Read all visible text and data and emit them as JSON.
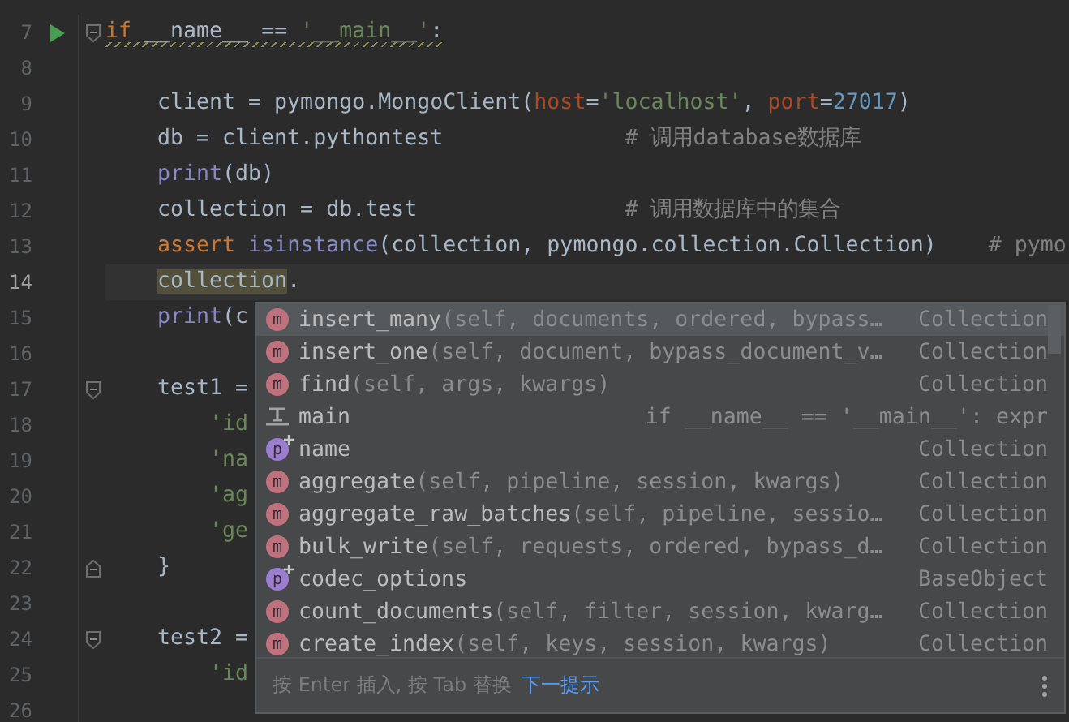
{
  "editor": {
    "lines": [
      {
        "number": "7",
        "current": false,
        "run": true,
        "fold_start": true,
        "warning": true,
        "tokens": [
          {
            "kind": "keyword",
            "text": "if"
          },
          {
            "kind": "plain",
            "text": " __name__ == "
          },
          {
            "kind": "string",
            "text": "'__main__'"
          },
          {
            "kind": "plain",
            "text": ":"
          }
        ],
        "children": [
          {
            "number": "8",
            "current": false
          },
          {
            "number": "9",
            "current": false,
            "tokens": [
              {
                "kind": "plain",
                "text": "client = pymongo.MongoClient("
              },
              {
                "kind": "param",
                "text": "host"
              },
              {
                "kind": "plain",
                "text": "="
              },
              {
                "kind": "string",
                "text": "'localhost'"
              },
              {
                "kind": "plain",
                "text": ", "
              },
              {
                "kind": "param",
                "text": "port"
              },
              {
                "kind": "plain",
                "text": "="
              },
              {
                "kind": "number",
                "text": "27017"
              },
              {
                "kind": "plain",
                "text": ")"
              }
            ]
          },
          {
            "number": "10",
            "current": false,
            "tokens": [
              {
                "kind": "plain",
                "text": "db = client.pythontest              "
              },
              {
                "kind": "comment",
                "text": "# 调用database数据库"
              }
            ]
          },
          {
            "number": "11",
            "current": false,
            "tokens": [
              {
                "kind": "builtin",
                "text": "print"
              },
              {
                "kind": "plain",
                "text": "(db)"
              }
            ]
          },
          {
            "number": "12",
            "current": false,
            "tokens": [
              {
                "kind": "plain",
                "text": "collection = db.test                "
              },
              {
                "kind": "comment",
                "text": "# 调用数据库中的集合"
              }
            ]
          },
          {
            "number": "13",
            "current": false,
            "tokens": [
              {
                "kind": "keyword",
                "text": "assert"
              },
              {
                "kind": "builtin",
                "text": " isinstance"
              },
              {
                "kind": "plain",
                "text": "(collection, pymongo.collection.Collection)    "
              },
              {
                "kind": "comment",
                "text": "# pymo"
              }
            ]
          },
          {
            "number": "14",
            "current": true,
            "tokens": [
              {
                "kind": "highlight",
                "text": "collection"
              },
              {
                "kind": "plain",
                "text": "."
              }
            ]
          },
          {
            "number": "15",
            "current": false,
            "tokens": [
              {
                "kind": "builtin",
                "text": "print"
              },
              {
                "kind": "plain",
                "text": "(c"
              }
            ]
          },
          {
            "number": "16",
            "current": false
          },
          {
            "number": "17",
            "current": false,
            "fold_start": true,
            "tokens": [
              {
                "kind": "plain",
                "text": "test1 ="
              }
            ],
            "children": [
              {
                "number": "18",
                "current": false,
                "tokens": [
                  {
                    "kind": "string",
                    "text": "'id"
                  }
                ]
              },
              {
                "number": "19",
                "current": false,
                "tokens": [
                  {
                    "kind": "string",
                    "text": "'na"
                  }
                ]
              },
              {
                "number": "20",
                "current": false,
                "tokens": [
                  {
                    "kind": "string",
                    "text": "'ag"
                  }
                ]
              },
              {
                "number": "21",
                "current": false,
                "tokens": [
                  {
                    "kind": "string",
                    "text": "'ge"
                  }
                ]
              }
            ]
          },
          {
            "number": "22",
            "current": false,
            "fold_end": true,
            "tokens": [
              {
                "kind": "plain",
                "text": "}"
              }
            ]
          },
          {
            "number": "23",
            "current": false
          },
          {
            "number": "24",
            "current": false,
            "fold_start": true,
            "tokens": [
              {
                "kind": "plain",
                "text": "test2 ="
              }
            ],
            "children": [
              {
                "number": "25",
                "current": false,
                "tokens": [
                  {
                    "kind": "string",
                    "text": "'id"
                  }
                ]
              },
              {
                "number": "26",
                "current": false
              }
            ]
          }
        ]
      }
    ]
  },
  "completion": {
    "items": [
      {
        "kind": "method",
        "icon": "m",
        "name": "insert_many",
        "params": "(self, documents, ordered, bypass…",
        "type": "Collection",
        "selected": true
      },
      {
        "kind": "method",
        "icon": "m",
        "name": "insert_one",
        "params": "(self, document, bypass_document_v…",
        "type": "Collection",
        "selected": false
      },
      {
        "kind": "method",
        "icon": "m",
        "name": "find",
        "params": "(self, args, kwargs)",
        "type": "Collection",
        "selected": false
      },
      {
        "kind": "template",
        "name": "main",
        "type": "if __name__ == '__main__': expr",
        "selected": false
      },
      {
        "kind": "property",
        "icon": "p",
        "name": "name",
        "type": "Collection",
        "selected": false
      },
      {
        "kind": "method",
        "icon": "m",
        "name": "aggregate",
        "params": "(self, pipeline, session, kwargs)",
        "type": "Collection",
        "selected": false
      },
      {
        "kind": "method",
        "icon": "m",
        "name": "aggregate_raw_batches",
        "params": "(self, pipeline, sessio…",
        "type": "Collection",
        "selected": false
      },
      {
        "kind": "method",
        "icon": "m",
        "name": "bulk_write",
        "params": "(self, requests, ordered, bypass_d…",
        "type": "Collection",
        "selected": false
      },
      {
        "kind": "property",
        "icon": "p",
        "name": "codec_options",
        "type": "BaseObject",
        "selected": false
      },
      {
        "kind": "method",
        "icon": "m",
        "name": "count_documents",
        "params": "(self, filter, session, kwarg…",
        "type": "Collection",
        "selected": false
      },
      {
        "kind": "method",
        "icon": "m",
        "name": "create_index",
        "params": "(self, keys, session, kwargs)",
        "type": "Collection",
        "selected": false
      }
    ],
    "footer": {
      "hint": "按 Enter 插入, 按 Tab 替换",
      "link": "下一提示"
    }
  }
}
